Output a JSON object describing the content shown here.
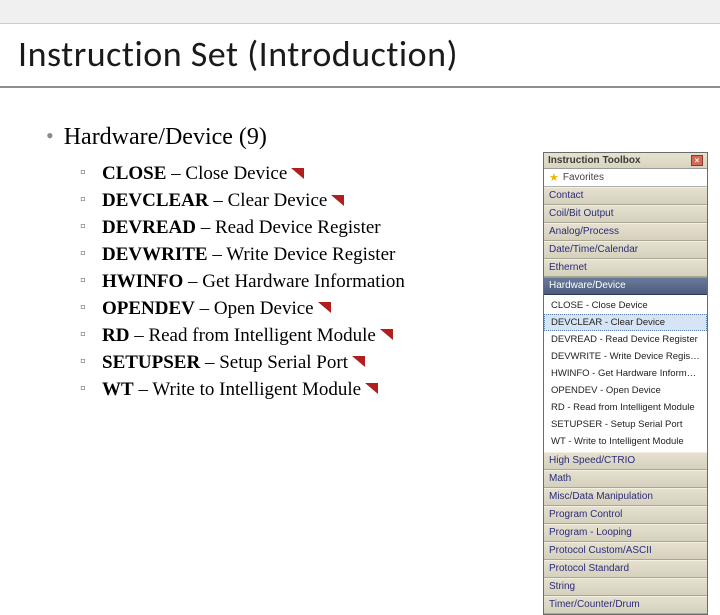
{
  "slide": {
    "title": "Instruction Set (Introduction)",
    "section_heading": "Hardware/Device (9)",
    "items": [
      {
        "cmd": "CLOSE",
        "desc": " – Close Device",
        "flag": true
      },
      {
        "cmd": "DEVCLEAR",
        "desc": " – Clear Device",
        "flag": true
      },
      {
        "cmd": "DEVREAD",
        "desc": " – Read Device Register",
        "flag": false
      },
      {
        "cmd": "DEVWRITE",
        "desc": " – Write Device Register",
        "flag": false
      },
      {
        "cmd": "HWINFO",
        "desc": " – Get Hardware Information",
        "flag": false
      },
      {
        "cmd": "OPENDEV",
        "desc": " – Open Device",
        "flag": true
      },
      {
        "cmd": "RD",
        "desc": " – Read from Intelligent Module",
        "flag": true
      },
      {
        "cmd": "SETUPSER",
        "desc": " – Setup Serial Port",
        "flag": true
      },
      {
        "cmd": "WT",
        "desc": " – Write to Intelligent Module",
        "flag": true
      }
    ]
  },
  "toolbox": {
    "title": "Instruction Toolbox",
    "favorites": "Favorites",
    "categories_top": [
      "Contact",
      "Coil/Bit Output",
      "Analog/Process",
      "Date/Time/Calendar",
      "Ethernet"
    ],
    "active_category": "Hardware/Device",
    "active_items": [
      "CLOSE - Close Device",
      "DEVCLEAR - Clear Device",
      "DEVREAD - Read Device Register",
      "DEVWRITE - Write Device Register",
      "HWINFO - Get Hardware Information",
      "OPENDEV - Open Device",
      "RD - Read from Intelligent Module",
      "SETUPSER - Setup Serial Port",
      "WT - Write to Intelligent Module"
    ],
    "selected_item_index": 1,
    "categories_bottom": [
      "High Speed/CTRIO",
      "Math",
      "Misc/Data Manipulation",
      "Program Control",
      "Program - Looping",
      "Protocol Custom/ASCII",
      "Protocol Standard",
      "String",
      "Timer/Counter/Drum"
    ]
  }
}
